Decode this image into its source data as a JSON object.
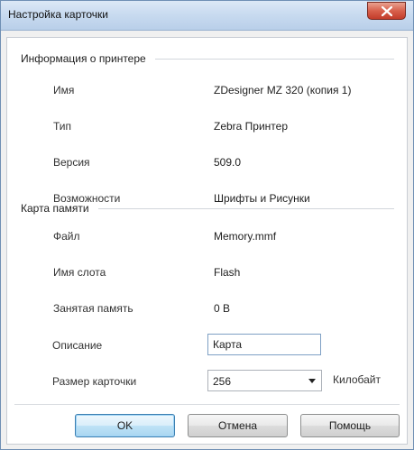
{
  "window": {
    "title": "Настройка карточки"
  },
  "printer_info": {
    "header": "Информация о принтере",
    "rows": [
      {
        "label": "Имя",
        "value": "ZDesigner MZ 320 (копия 1)"
      },
      {
        "label": "Тип",
        "value": "Zebra Принтер"
      },
      {
        "label": "Версия",
        "value": "509.0"
      },
      {
        "label": "Возможности",
        "value": "Шрифты и Рисунки"
      }
    ]
  },
  "memory_card": {
    "header": "Карта памяти",
    "rows": [
      {
        "label": "Файл",
        "value": "Memory.mmf"
      },
      {
        "label": "Имя слота",
        "value": "Flash"
      },
      {
        "label": "Занятая память",
        "value": "0 B"
      }
    ],
    "description": {
      "label": "Описание",
      "value": "Карта"
    },
    "card_size": {
      "label": "Размер карточки",
      "value": "256",
      "unit": "Килобайт"
    }
  },
  "buttons": {
    "ok": "OK",
    "cancel": "Отмена",
    "help": "Помощь"
  },
  "colors": {
    "close_button": "#d8604c",
    "default_button_border": "#3c7fb1"
  }
}
